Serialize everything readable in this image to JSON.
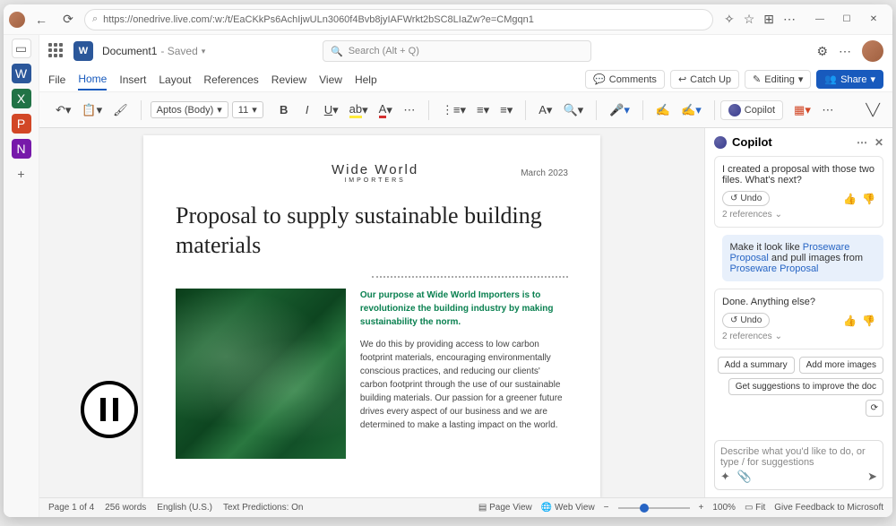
{
  "browser": {
    "url": "https://onedrive.live.com/:w:/t/EaCKkPs6AchIjwULn3060f4Bvb8jyIAFWrkt2bSC8LIaZw?e=CMgqn1"
  },
  "header": {
    "doc_name": "Document1",
    "doc_state": "Saved",
    "search_placeholder": "Search (Alt + Q)"
  },
  "tabs": {
    "file": "File",
    "home": "Home",
    "insert": "Insert",
    "layout": "Layout",
    "references": "References",
    "review": "Review",
    "view": "View",
    "help": "Help"
  },
  "ribbon_actions": {
    "comments": "Comments",
    "catch_up": "Catch Up",
    "editing": "Editing",
    "share": "Share"
  },
  "toolbar": {
    "font_name": "Aptos (Body)",
    "font_size": "11",
    "copilot_label": "Copilot"
  },
  "document": {
    "brand": "Wide World",
    "brand_sub": "IMPORTERS",
    "date": "March 2023",
    "title": "Proposal to supply sustainable building materials",
    "purpose": "Our purpose at Wide World Importers is to revolutionize the building industry by making sustainability the norm.",
    "body": "We do this by providing access to low carbon footprint materials, encouraging environmentally conscious practices, and reducing our clients' carbon footprint through the use of our sustainable building materials. Our passion for a greener future drives every aspect of our business and we are determined to make a lasting impact on the world."
  },
  "copilot": {
    "title": "Copilot",
    "msg1": "I created a proposal with those two files. What's next?",
    "undo": "Undo",
    "refs": "2 references",
    "user_prefix": "Make it look like ",
    "user_link1": "Proseware Proposal",
    "user_mid": " and pull images from ",
    "user_link2": "Proseware Proposal",
    "msg2": "Done. Anything else?",
    "chip1": "Add a summary",
    "chip2": "Add more images",
    "chip3": "Get suggestions to improve the doc",
    "input_placeholder": "Describe what you'd like to do, or type / for suggestions"
  },
  "status": {
    "page": "Page 1 of 4",
    "words": "256 words",
    "lang": "English (U.S.)",
    "predictions": "Text Predictions: On",
    "page_view": "Page View",
    "web_view": "Web View",
    "zoom": "100%",
    "fit": "Fit",
    "feedback": "Give Feedback to Microsoft"
  }
}
